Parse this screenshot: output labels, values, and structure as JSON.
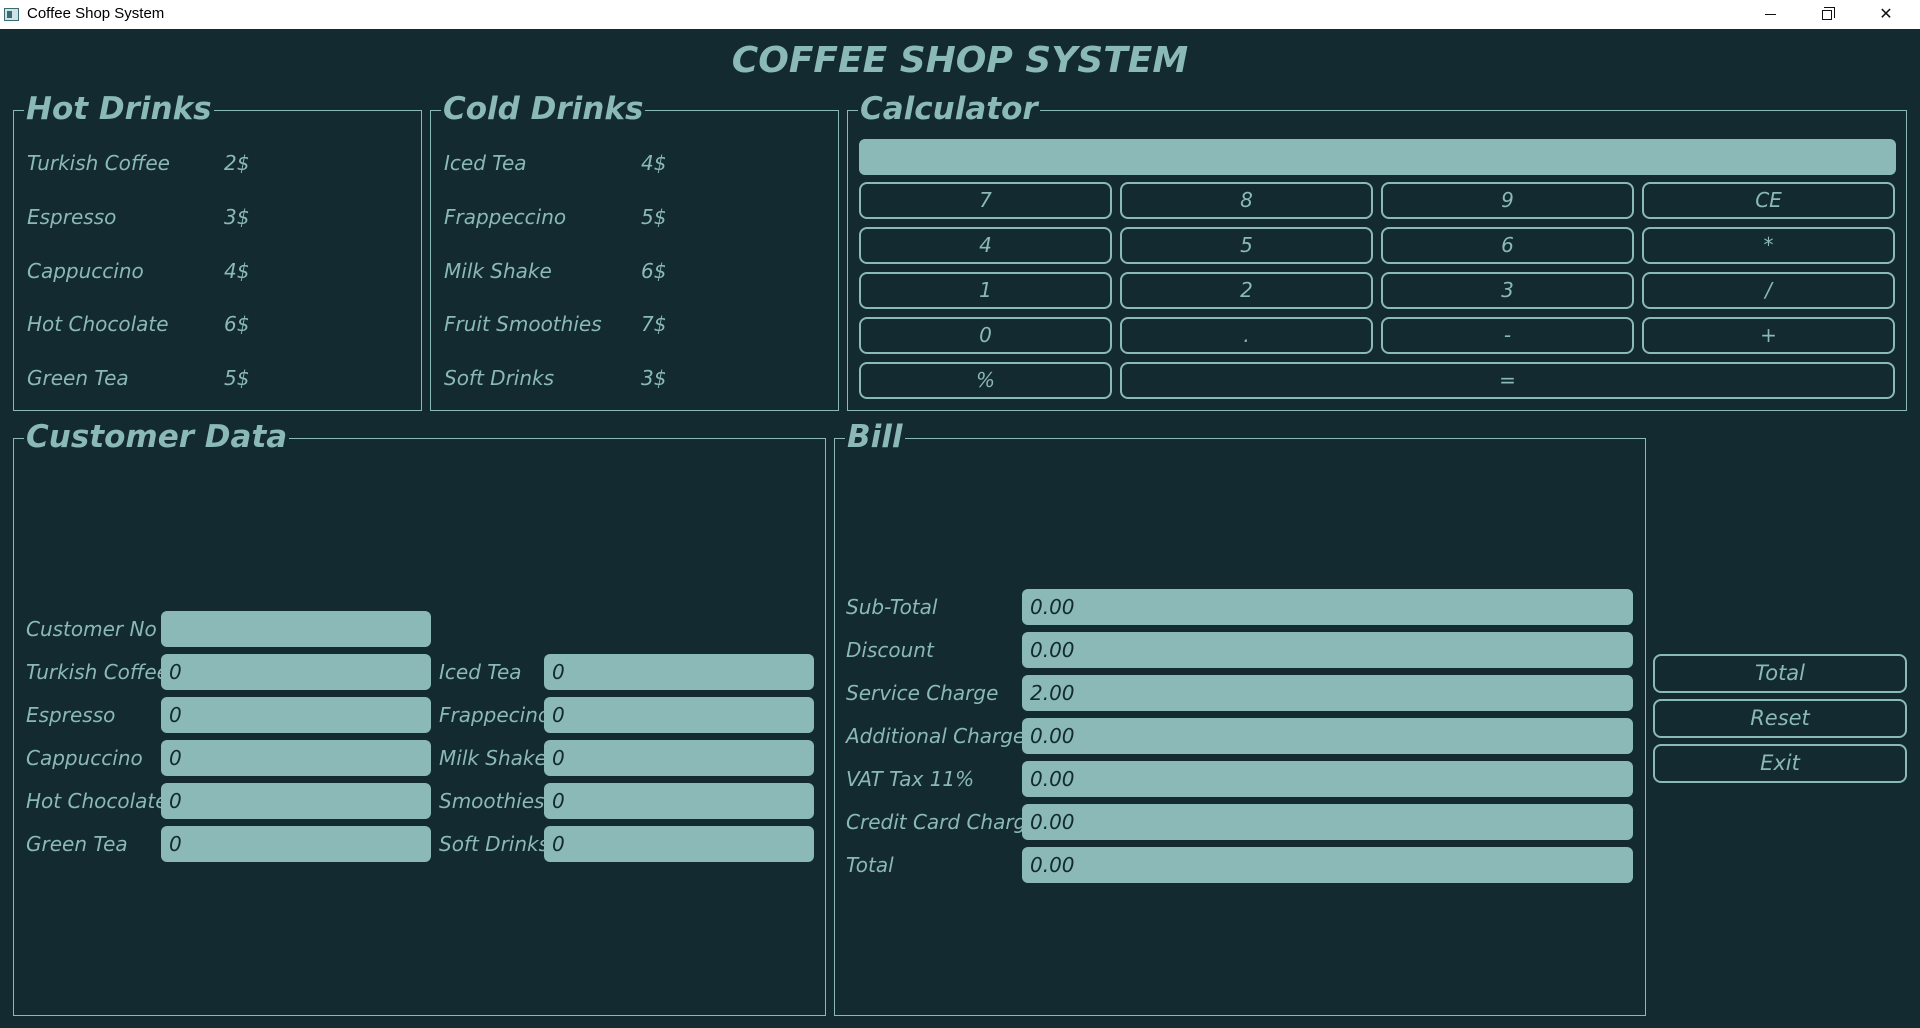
{
  "window": {
    "title": "Coffee Shop System",
    "minimize": "minimize-icon",
    "maximize": "restore-icon",
    "close": "✕"
  },
  "header": {
    "title": "COFFEE SHOP SYSTEM"
  },
  "hot_drinks": {
    "title": "Hot Drinks",
    "items": [
      {
        "name": "Turkish Coffee",
        "price": "2$"
      },
      {
        "name": "Espresso",
        "price": "3$"
      },
      {
        "name": "Cappuccino",
        "price": "4$"
      },
      {
        "name": "Hot Chocolate",
        "price": "6$"
      },
      {
        "name": "Green Tea",
        "price": "5$"
      }
    ]
  },
  "cold_drinks": {
    "title": "Cold Drinks",
    "items": [
      {
        "name": "Iced Tea",
        "price": "4$"
      },
      {
        "name": "Frappeccino",
        "price": "5$"
      },
      {
        "name": "Milk Shake",
        "price": "6$"
      },
      {
        "name": "Fruit Smoothies",
        "price": "7$"
      },
      {
        "name": "Soft Drinks",
        "price": "3$"
      }
    ]
  },
  "calculator": {
    "title": "Calculator",
    "display": "",
    "buttons": [
      "7",
      "8",
      "9",
      "CE",
      "4",
      "5",
      "6",
      "*",
      "1",
      "2",
      "3",
      "/",
      "0",
      ".",
      "-",
      "+",
      "%",
      "="
    ]
  },
  "customer": {
    "title": "Customer Data",
    "customer_no_label": "Customer No",
    "customer_no_value": "",
    "left": [
      {
        "label": "Turkish Coffee",
        "value": "0"
      },
      {
        "label": "Espresso",
        "value": "0"
      },
      {
        "label": "Cappuccino",
        "value": "0"
      },
      {
        "label": "Hot Chocolate",
        "value": "0"
      },
      {
        "label": "Green Tea",
        "value": "0"
      }
    ],
    "right": [
      {
        "label": "Iced Tea",
        "value": "0"
      },
      {
        "label": "Frappecino",
        "value": "0"
      },
      {
        "label": "Milk Shake",
        "value": "0"
      },
      {
        "label": "Smoothies",
        "value": "0"
      },
      {
        "label": "Soft Drinks",
        "value": "0"
      }
    ]
  },
  "bill": {
    "title": "Bill",
    "rows": [
      {
        "label": "Sub-Total",
        "value": "0.00"
      },
      {
        "label": "Discount",
        "value": "0.00"
      },
      {
        "label": "Service Charge",
        "value": "2.00"
      },
      {
        "label": "Additional Charge",
        "value": "0.00"
      },
      {
        "label": "VAT Tax 11%",
        "value": "0.00"
      },
      {
        "label": "Credit Card Charge",
        "value": "0.00"
      },
      {
        "label": "Total",
        "value": "0.00"
      }
    ]
  },
  "actions": {
    "total": "Total",
    "reset": "Reset",
    "exit": "Exit"
  }
}
